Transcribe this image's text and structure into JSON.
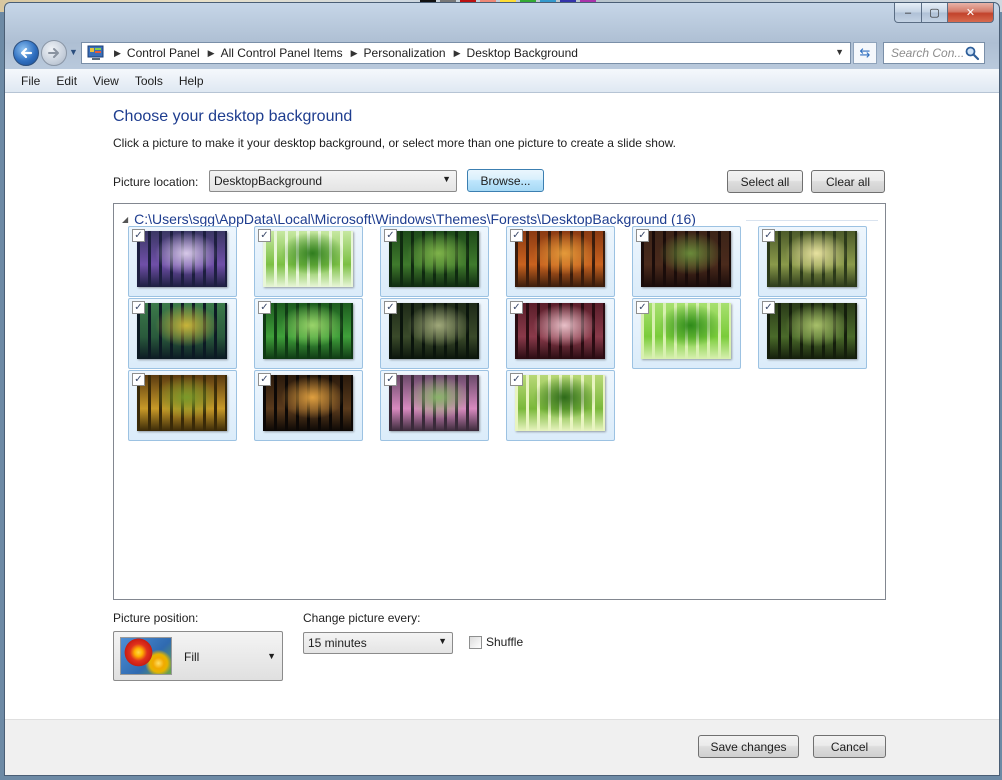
{
  "window": {
    "caption": {
      "minimize_glyph": "–",
      "maximize_glyph": "▢",
      "close_glyph": "✕"
    }
  },
  "addressbar": {
    "crumbs": [
      "Control Panel",
      "All Control Panel Items",
      "Personalization",
      "Desktop Background"
    ],
    "search_placeholder": "Search Con...",
    "icons": {
      "back": "back-arrow-icon",
      "forward": "forward-arrow-icon",
      "refresh": "refresh-icon",
      "search": "magnifier-icon",
      "location": "control-panel-icon"
    }
  },
  "menu": [
    "File",
    "Edit",
    "View",
    "Tools",
    "Help"
  ],
  "content": {
    "title": "Choose your desktop background",
    "subtitle": "Click a picture to make it your desktop background, or select more than one picture to create a slide show.",
    "picture_location_label": "Picture location:",
    "picture_location_value": "DesktopBackground",
    "browse_label": "Browse...",
    "select_all_label": "Select all",
    "clear_all_label": "Clear all",
    "group_header": "C:\\Users\\sgg\\AppData\\Local\\Microsoft\\Windows\\Themes\\Forests\\DesktopBackground (16)",
    "thumbnails": [
      {
        "checked": true,
        "palette": [
          "#1d1f40",
          "#6f4fa8",
          "#d7c9e8",
          "#3a3764"
        ]
      },
      {
        "checked": true,
        "palette": [
          "#e8f6d8",
          "#7bc043",
          "#2f7d1e",
          "#c7e8a2"
        ]
      },
      {
        "checked": true,
        "palette": [
          "#0f2a10",
          "#3f7a2c",
          "#7fb34a",
          "#1e4a1a"
        ]
      },
      {
        "checked": true,
        "palette": [
          "#3a1c0c",
          "#c9621f",
          "#e49a3a",
          "#8a3a12"
        ]
      },
      {
        "checked": true,
        "palette": [
          "#1a0c0a",
          "#4a2a1c",
          "#6a8a3a",
          "#3c2418"
        ]
      },
      {
        "checked": true,
        "palette": [
          "#2c3a1a",
          "#8a9a4a",
          "#e8e2a0",
          "#4c5a2a"
        ]
      },
      {
        "checked": true,
        "palette": [
          "#0c1a24",
          "#2a5a3c",
          "#c9b43a",
          "#3c7a4a"
        ]
      },
      {
        "checked": true,
        "palette": [
          "#0f3a14",
          "#3fa03a",
          "#9ad46a",
          "#1c5a1e"
        ]
      },
      {
        "checked": true,
        "palette": [
          "#0a140c",
          "#3a4a2a",
          "#a0a87a",
          "#1e2a18"
        ]
      },
      {
        "checked": true,
        "palette": [
          "#2a0c12",
          "#8a3a4a",
          "#e8c0c8",
          "#5a1e2a"
        ]
      },
      {
        "checked": true,
        "palette": [
          "#d8f0b0",
          "#7acc3a",
          "#2e8a1a",
          "#a8e070"
        ]
      },
      {
        "checked": true,
        "palette": [
          "#141e0c",
          "#4a6a2a",
          "#a8c06a",
          "#2a3a18"
        ]
      },
      {
        "checked": true,
        "palette": [
          "#3a2a08",
          "#c89a28",
          "#7a9a2a",
          "#5a3a10"
        ]
      },
      {
        "checked": true,
        "palette": [
          "#0c0806",
          "#5a3a1c",
          "#e0a040",
          "#2a1a0c"
        ]
      },
      {
        "checked": true,
        "palette": [
          "#3a2a3a",
          "#d88ac0",
          "#8ab46a",
          "#6a4a6a"
        ]
      },
      {
        "checked": true,
        "palette": [
          "#e8f4c0",
          "#7ab83a",
          "#2e6a1a",
          "#b8d878"
        ]
      }
    ],
    "picture_position_label": "Picture position:",
    "picture_position_value": "Fill",
    "change_picture_label": "Change picture every:",
    "change_picture_value": "15 minutes",
    "shuffle_label": "Shuffle",
    "shuffle_checked": false
  },
  "footer": {
    "save_label": "Save changes",
    "cancel_label": "Cancel"
  },
  "colors": {
    "title_blue": "#1e3d8f",
    "selection_border": "#9cc2e2",
    "footer_bg": "#f0f0f0"
  }
}
